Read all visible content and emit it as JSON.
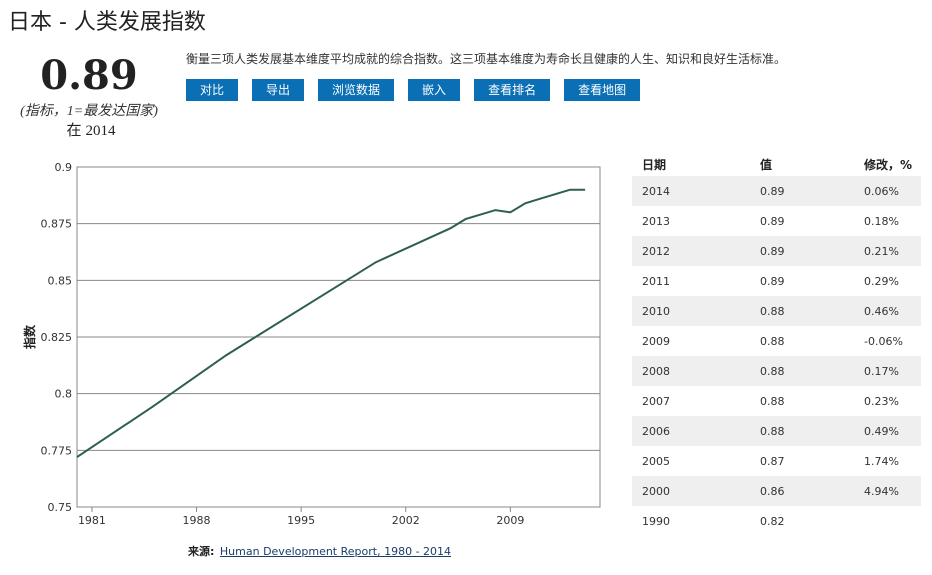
{
  "page": {
    "title": "日本 - 人类发展指数",
    "big_value": "0.89",
    "value_note": "(指标，1=最发达国家)",
    "year_prefix": "在",
    "year": "2014",
    "description": "衡量三项人类发展基本维度平均成就的综合指数。这三项基本维度为寿命长且健康的人生、知识和良好生活标准。"
  },
  "actions": {
    "compare": "对比",
    "export": "导出",
    "browse": "浏览数据",
    "embed": "嵌入",
    "ranking": "查看排名",
    "map": "查看地图"
  },
  "source": {
    "label": "来源:",
    "link": "Human Development Report, 1980 - 2014"
  },
  "table": {
    "headers": [
      "日期",
      "值",
      "修改，%"
    ],
    "rows": [
      [
        "2014",
        "0.89",
        "0.06%"
      ],
      [
        "2013",
        "0.89",
        "0.18%"
      ],
      [
        "2012",
        "0.89",
        "0.21%"
      ],
      [
        "2011",
        "0.89",
        "0.29%"
      ],
      [
        "2010",
        "0.88",
        "0.46%"
      ],
      [
        "2009",
        "0.88",
        "-0.06%"
      ],
      [
        "2008",
        "0.88",
        "0.17%"
      ],
      [
        "2007",
        "0.88",
        "0.23%"
      ],
      [
        "2006",
        "0.88",
        "0.49%"
      ],
      [
        "2005",
        "0.87",
        "1.74%"
      ],
      [
        "2000",
        "0.86",
        "4.94%"
      ],
      [
        "1990",
        "0.82",
        ""
      ]
    ]
  },
  "colors": {
    "line": "#2e5e4e",
    "button": "#0a6fb4",
    "row_shade": "#efefef"
  },
  "chart_data": {
    "type": "line",
    "title": "",
    "xlabel": "",
    "ylabel": "指数",
    "xlim": [
      1980,
      2015
    ],
    "ylim": [
      0.75,
      0.9
    ],
    "yticks": [
      0.75,
      0.775,
      0.8,
      0.825,
      0.85,
      0.875,
      0.9
    ],
    "ytick_labels": [
      "0.75",
      "0.775",
      "0.8",
      "0.825",
      "0.85",
      "0.875",
      "0.9"
    ],
    "xticks": [
      1981,
      1988,
      1995,
      2002,
      2009
    ],
    "xtick_labels": [
      "1981",
      "1988",
      "1995",
      "2002",
      "2009"
    ],
    "grid": true,
    "series": [
      {
        "x": [
          1980,
          1985,
          1990,
          2000,
          2005,
          2006,
          2007,
          2008,
          2009,
          2010,
          2011,
          2012,
          2013,
          2014
        ],
        "y": [
          0.772,
          0.794,
          0.817,
          0.858,
          0.873,
          0.877,
          0.879,
          0.881,
          0.88,
          0.884,
          0.886,
          0.888,
          0.89,
          0.89
        ]
      }
    ]
  }
}
